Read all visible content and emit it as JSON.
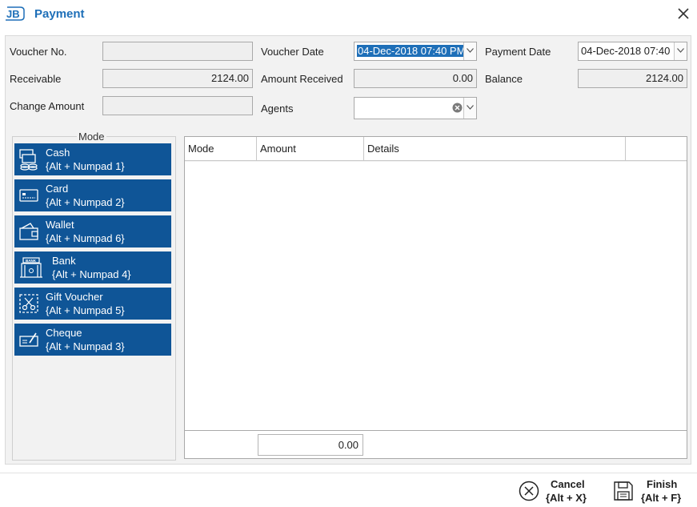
{
  "window": {
    "title": "Payment",
    "logo_text": "JB"
  },
  "form": {
    "voucher_no": {
      "label": "Voucher No.",
      "value": ""
    },
    "voucher_date": {
      "label": "Voucher Date",
      "value": "04-Dec-2018 07:40 PM"
    },
    "payment_date": {
      "label": "Payment Date",
      "value": "04-Dec-2018 07:40"
    },
    "receivable": {
      "label": "Receivable",
      "value": "2124.00"
    },
    "amount_received": {
      "label": "Amount Received",
      "value": "0.00"
    },
    "balance": {
      "label": "Balance",
      "value": "2124.00"
    },
    "change_amount": {
      "label": "Change Amount",
      "value": ""
    },
    "agents": {
      "label": "Agents",
      "value": ""
    }
  },
  "mode": {
    "legend": "Mode",
    "buttons": [
      {
        "label": "Cash",
        "shortcut": "{Alt + Numpad 1}",
        "icon": "cash-icon"
      },
      {
        "label": "Card",
        "shortcut": "{Alt + Numpad 2}",
        "icon": "card-icon"
      },
      {
        "label": "Wallet",
        "shortcut": "{Alt + Numpad 6}",
        "icon": "wallet-icon"
      },
      {
        "label": "Bank",
        "shortcut": "{Alt + Numpad 4}",
        "icon": "bank-icon"
      },
      {
        "label": "Gift Voucher",
        "shortcut": "{Alt + Numpad 5}",
        "icon": "gift-voucher-icon"
      },
      {
        "label": "Cheque",
        "shortcut": "{Alt + Numpad 3}",
        "icon": "cheque-icon"
      }
    ]
  },
  "grid": {
    "columns": [
      "Mode",
      "Amount",
      "Details",
      ""
    ],
    "rows": [],
    "total": "0.00"
  },
  "footer": {
    "cancel": {
      "label": "Cancel",
      "shortcut": "{Alt + X}",
      "icon": "cancel-icon"
    },
    "finish": {
      "label": "Finish",
      "shortcut": "{Alt + F}",
      "icon": "save-icon"
    }
  },
  "colors": {
    "accent": "#0f5597",
    "title": "#1e6fb8",
    "selection": "#1e6fb8"
  }
}
